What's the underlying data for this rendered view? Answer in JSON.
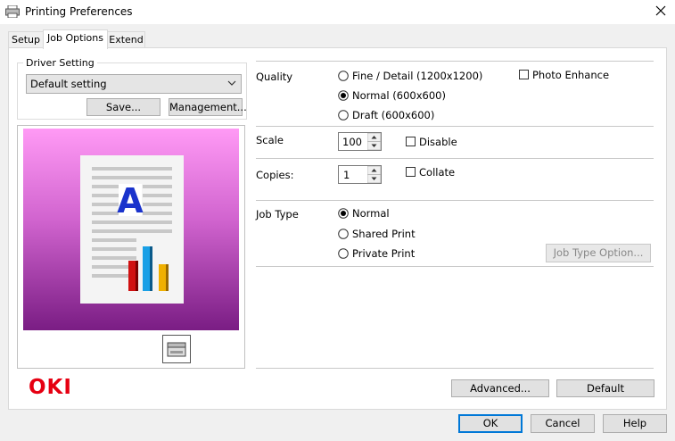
{
  "window": {
    "title": "Printing Preferences"
  },
  "tabs": [
    {
      "label": "Setup"
    },
    {
      "label": "Job Options"
    },
    {
      "label": "Extend"
    }
  ],
  "driver_setting": {
    "group_label": "Driver Setting",
    "selected": "Default setting",
    "save_label": "Save...",
    "management_label": "Management..."
  },
  "quality": {
    "label": "Quality",
    "options": [
      {
        "label": "Fine / Detail (1200x1200)",
        "selected": false
      },
      {
        "label": "Normal (600x600)",
        "selected": true
      },
      {
        "label": "Draft (600x600)",
        "selected": false
      }
    ],
    "photo_enhance_label": "Photo Enhance",
    "photo_enhance_checked": false
  },
  "scale": {
    "label": "Scale",
    "value": "100",
    "disable_label": "Disable",
    "disable_checked": false
  },
  "copies": {
    "label": "Copies:",
    "value": "1",
    "collate_label": "Collate",
    "collate_checked": false
  },
  "job_type": {
    "label": "Job Type",
    "options": [
      {
        "label": "Normal",
        "selected": true
      },
      {
        "label": "Shared Print",
        "selected": false
      },
      {
        "label": "Private Print",
        "selected": false
      }
    ],
    "option_button_label": "Job Type Option..."
  },
  "preview": {
    "letter": "A"
  },
  "brand": {
    "logo_text": "OKI",
    "color": "#e60012"
  },
  "buttons": {
    "advanced": "Advanced...",
    "default": "Default",
    "ok": "OK",
    "cancel": "Cancel",
    "help": "Help"
  }
}
